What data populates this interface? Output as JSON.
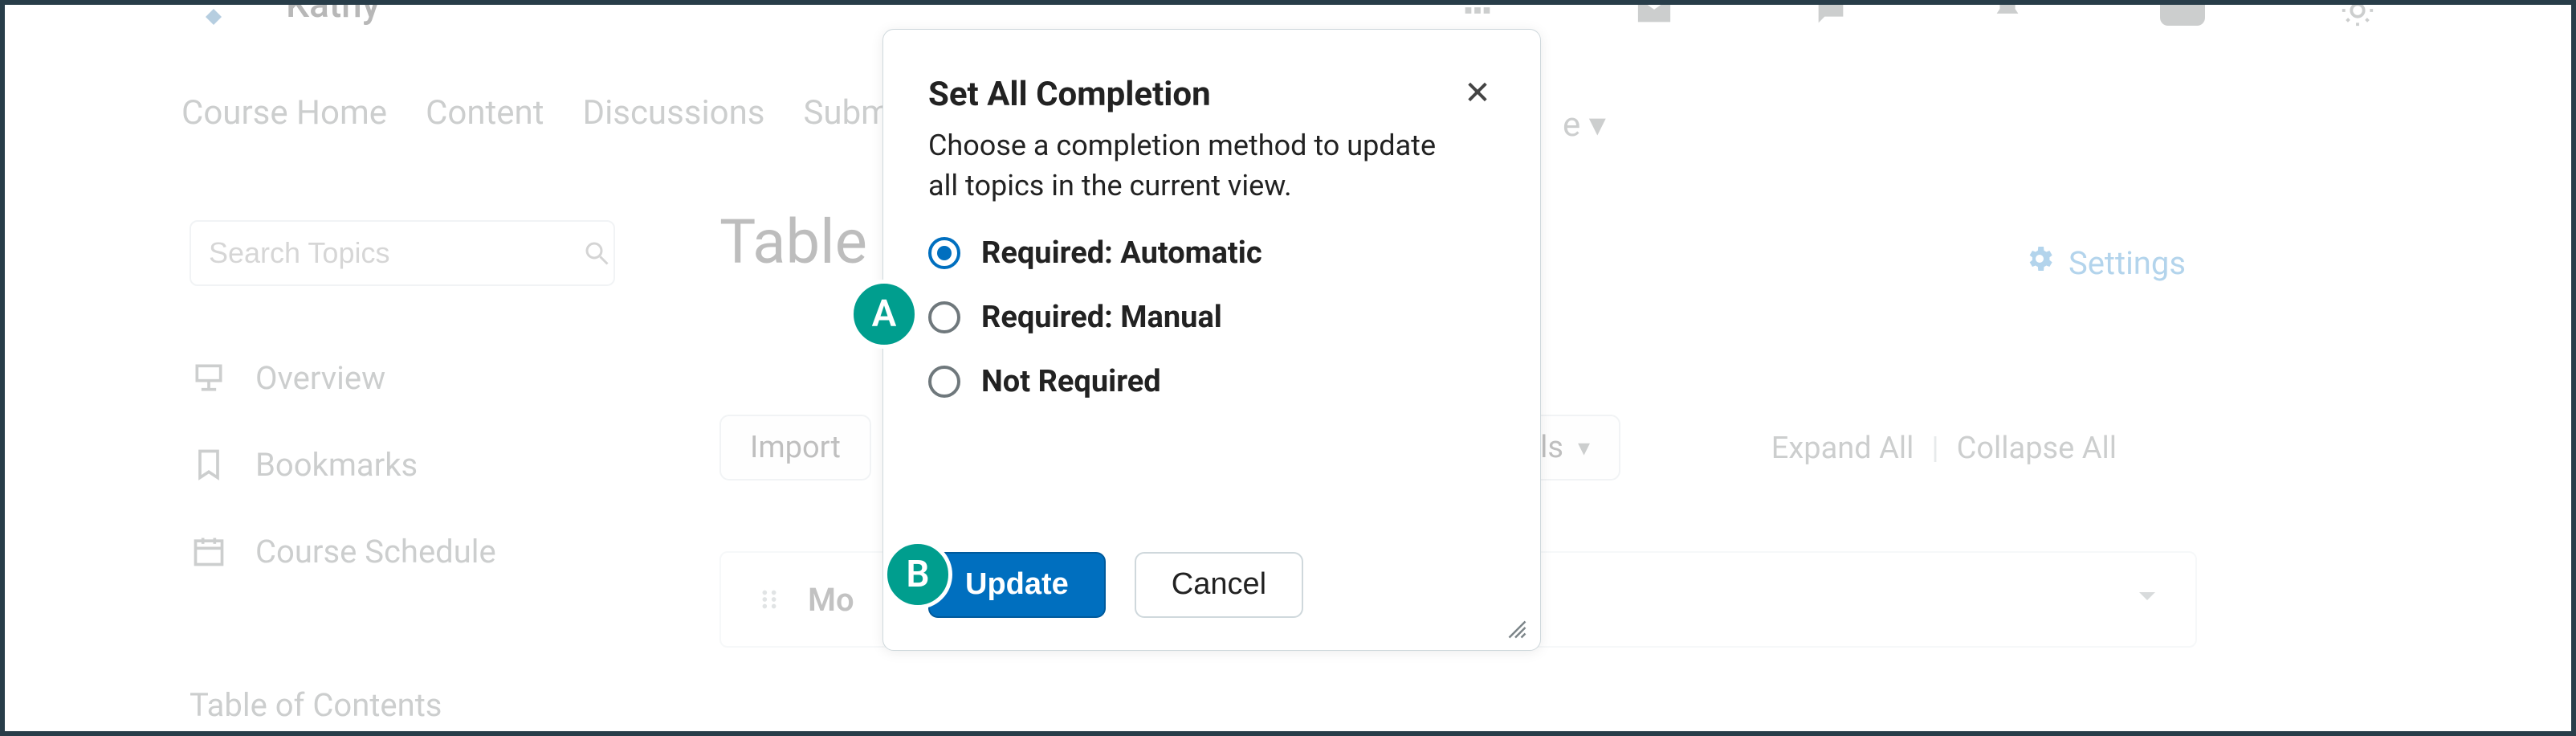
{
  "header": {
    "user_name": "Kathy"
  },
  "nav": {
    "items": [
      "Course Home",
      "Content",
      "Discussions",
      "Submis"
    ],
    "more_indicator": "e"
  },
  "sidebar": {
    "search_placeholder": "Search Topics",
    "items": [
      {
        "icon": "projector-icon",
        "label": "Overview"
      },
      {
        "icon": "bookmark-icon",
        "label": "Bookmarks"
      },
      {
        "icon": "calendar-icon",
        "label": "Course Schedule"
      }
    ],
    "toc_label": "Table of Contents"
  },
  "main": {
    "page_title": "Table",
    "settings_label": "Settings",
    "import_label": "Import",
    "tools_label": "Tools",
    "expand_label": "Expand All",
    "collapse_label": "Collapse All",
    "module_title_partial": "Mo"
  },
  "modal": {
    "title": "Set All Completion",
    "subtitle": "Choose a completion method to update all topics in the current view.",
    "options": [
      {
        "label": "Required: Automatic",
        "selected": true
      },
      {
        "label": "Required: Manual",
        "selected": false
      },
      {
        "label": "Not Required",
        "selected": false
      }
    ],
    "primary_label": "Update",
    "secondary_label": "Cancel"
  },
  "annotations": {
    "a": "A",
    "b": "B"
  }
}
